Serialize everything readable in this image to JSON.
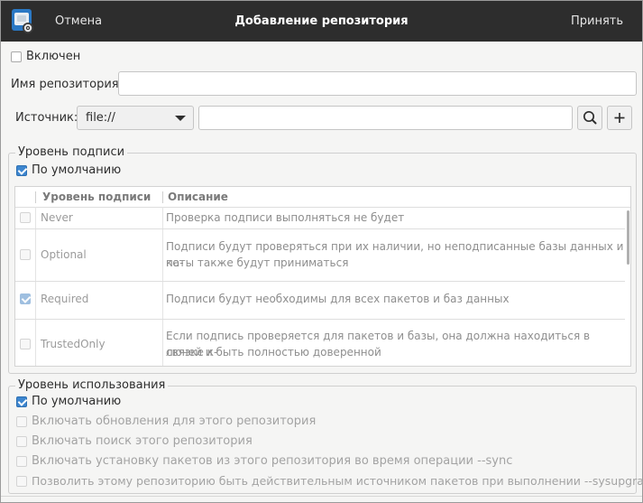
{
  "header": {
    "cancel_label": "Отмена",
    "title": "Добавление репозитория",
    "accept_label": "Принять"
  },
  "enabled": {
    "label": "Включен",
    "checked": false
  },
  "repo_name": {
    "label": "Имя репозитория:",
    "value": ""
  },
  "source": {
    "label": "Источник:",
    "protocol_selected": "file://",
    "path_value": ""
  },
  "signature": {
    "frame_label": "Уровень подписи",
    "default_label": "По умолчанию",
    "default_checked": true,
    "columns": [
      "Уровень подписи",
      "Описание"
    ],
    "rows": [
      {
        "level": "Never",
        "checked": false,
        "desc": [
          "Проверка подписи выполняться не будет"
        ]
      },
      {
        "level": "Optional",
        "checked": false,
        "desc": [
          "Подписи будут проверяться при их наличии, но неподписанные базы данных и па-",
          "кеты также будут приниматься"
        ]
      },
      {
        "level": "Required",
        "checked": true,
        "desc": [
          "Подписи будут необходимы для всех пакетов и баз данных"
        ]
      },
      {
        "level": "TrustedOnly",
        "checked": false,
        "desc": [
          "Если подпись проверяется для пакетов и базы, она должна находиться в связке к-",
          "лючей и быть полностью доверенной"
        ]
      }
    ]
  },
  "usage": {
    "frame_label": "Уровень использования",
    "default_label": "По умолчанию",
    "default_checked": true,
    "options": [
      "Включать обновления для этого репозитория",
      "Включать поиск этого репозитория",
      "Включать установку пакетов из этого репозитория во время операции --sync",
      "Позволить этому репозиторию быть действительным источником пакетов при выполнении --sysupgrade"
    ]
  },
  "colors": {
    "headerbar": "#2d2d2d",
    "accent": "#3d86cf",
    "window_bg": "#f5f5f4"
  },
  "icons": [
    "app-package-settings-icon",
    "search-icon",
    "plus-icon",
    "chevron-down-icon"
  ]
}
